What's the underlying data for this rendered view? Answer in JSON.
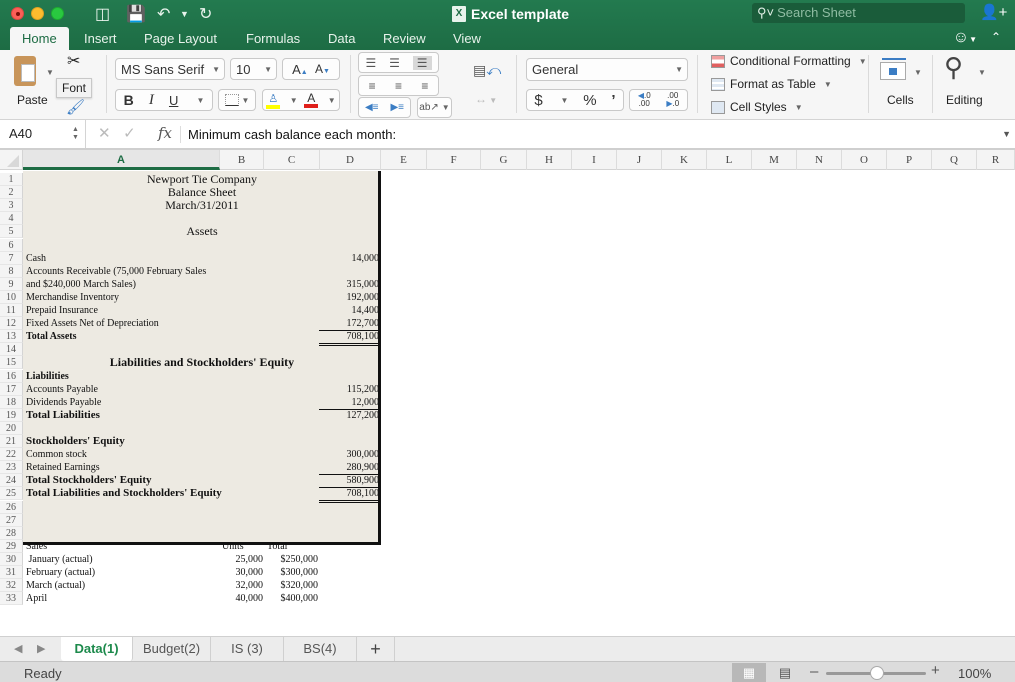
{
  "window": {
    "title": "Excel template",
    "search_placeholder": "Search Sheet"
  },
  "ribbon_tabs": [
    "Home",
    "Insert",
    "Page Layout",
    "Formulas",
    "Data",
    "Review",
    "View"
  ],
  "active_tab": "Home",
  "ribbon": {
    "paste_label": "Paste",
    "tooltip": "Font",
    "font_name": "MS Sans Serif",
    "font_size": "10",
    "bold": "B",
    "italic": "I",
    "underline": "U",
    "number_format": "General",
    "currency": "$",
    "percent": "%",
    "comma": "’",
    "increase_decimal": ".0 .00",
    "decrease_decimal": ".00 .0",
    "conditional_formatting": "Conditional Formatting",
    "format_as_table": "Format as Table",
    "cell_styles": "Cell Styles",
    "cells_label": "Cells",
    "editing_label": "Editing",
    "fill_color": "#ffff00",
    "font_color": "#e0201b"
  },
  "formula_bar": {
    "name_box": "A40",
    "content": "Minimum cash balance each month:"
  },
  "columns": [
    "A",
    "B",
    "C",
    "D",
    "E",
    "F",
    "G",
    "H",
    "I",
    "J",
    "K",
    "L",
    "M",
    "N",
    "O",
    "P",
    "Q",
    "R"
  ],
  "selected_column": "A",
  "rows": [
    "1",
    "2",
    "3",
    "4",
    "5",
    "6",
    "7",
    "8",
    "9",
    "10",
    "11",
    "12",
    "13",
    "14",
    "15",
    "16",
    "17",
    "18",
    "19",
    "20",
    "21",
    "22",
    "23",
    "24",
    "25",
    "26",
    "27",
    "28",
    "29",
    "30",
    "31",
    "32",
    "33"
  ],
  "balance_sheet": {
    "company": "Newport Tie Company",
    "title": "Balance Sheet",
    "date": "March/31/2011",
    "assets_heading": "Assets",
    "assets": [
      {
        "row": 7,
        "label": "Cash",
        "value": "14,000"
      },
      {
        "row": 8,
        "label": "Accounts Receivable (75,000 February Sales",
        "value": ""
      },
      {
        "row": 9,
        "label": "and $240,000 March Sales)",
        "value": "315,000"
      },
      {
        "row": 10,
        "label": "Merchandise Inventory",
        "value": "192,000"
      },
      {
        "row": 11,
        "label": "Prepaid Insurance",
        "value": "14,400"
      },
      {
        "row": 12,
        "label": "Fixed Assets Net of Depreciation",
        "value": "172,700"
      }
    ],
    "total_assets": {
      "label": "Total Assets",
      "value": "708,100"
    },
    "liab_heading": "Liabilities and Stockholders' Equity",
    "liabilities_heading": "Liabilities",
    "liabilities": [
      {
        "row": 17,
        "label": "Accounts Payable",
        "value": "115,200"
      },
      {
        "row": 18,
        "label": "Dividends Payable",
        "value": "12,000"
      }
    ],
    "total_liabilities": {
      "label": "Total Liabilities",
      "value": "127,200"
    },
    "equity_heading": "Stockholders' Equity",
    "equity": [
      {
        "row": 22,
        "label": "Common stock",
        "value": "300,000"
      },
      {
        "row": 23,
        "label": "Retained Earnings",
        "value": "280,900"
      }
    ],
    "total_equity": {
      "label": "Total  Stockholders' Equity",
      "value": "580,900"
    },
    "total_le": {
      "label": "Total Liabilities and Stockholders' Equity",
      "value": "708,100"
    }
  },
  "sales": {
    "label": "Sales",
    "units_header": "Units",
    "total_header": "Total",
    "rows": [
      {
        "month": " January (actual)",
        "units": "25,000",
        "total": "$250,000"
      },
      {
        "month": "February (actual)",
        "units": "30,000",
        "total": "$300,000"
      },
      {
        "month": "March (actual)",
        "units": "32,000",
        "total": "$320,000"
      },
      {
        "month": "April",
        "units": "40,000",
        "total": "$400,000"
      }
    ]
  },
  "sheet_tabs": [
    "Data(1)",
    "Budget(2)",
    "IS (3)",
    "BS(4)"
  ],
  "active_sheet": "Data(1)",
  "add_sheet": "+",
  "status": {
    "text": "Ready",
    "zoom": "100%",
    "zoom_percent": 100
  }
}
